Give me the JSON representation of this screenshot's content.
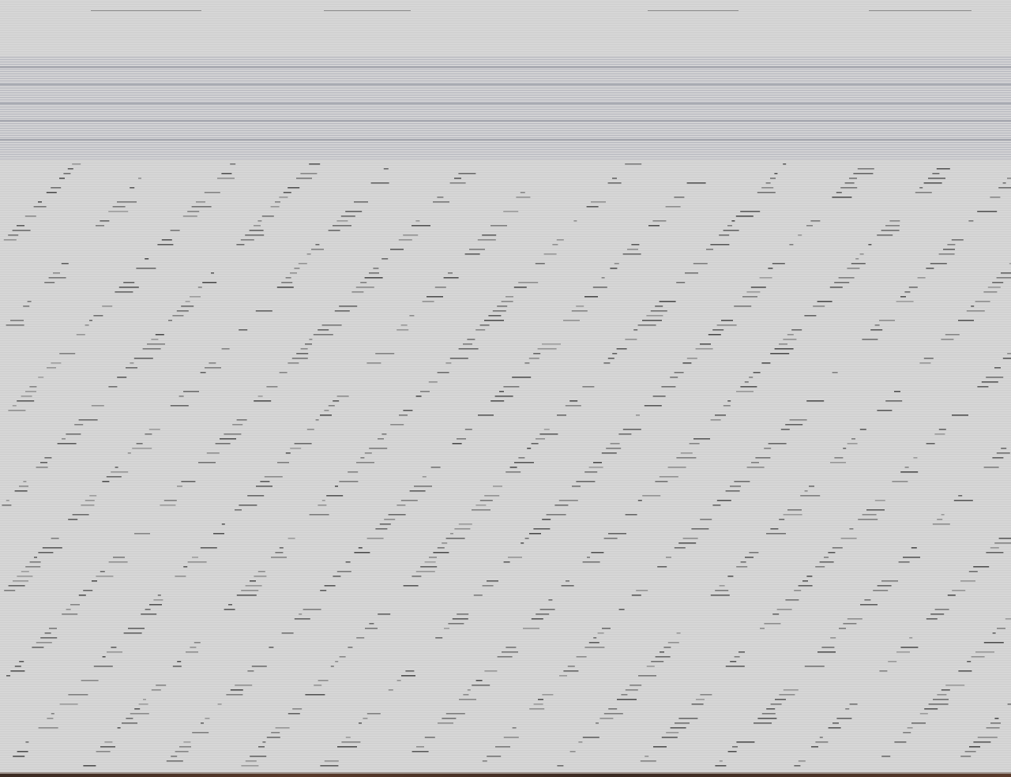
{
  "screen": {
    "description_visible_text": "",
    "colors": {
      "background": "#d4d4d4",
      "scanline": "#cfcfcf",
      "band": "#c9c9cc",
      "band_line": "#b8b9c0",
      "band_dark": "#5d6070",
      "diagonal": "#2a2a2a",
      "bottom_edge": "#3a2a22"
    }
  }
}
